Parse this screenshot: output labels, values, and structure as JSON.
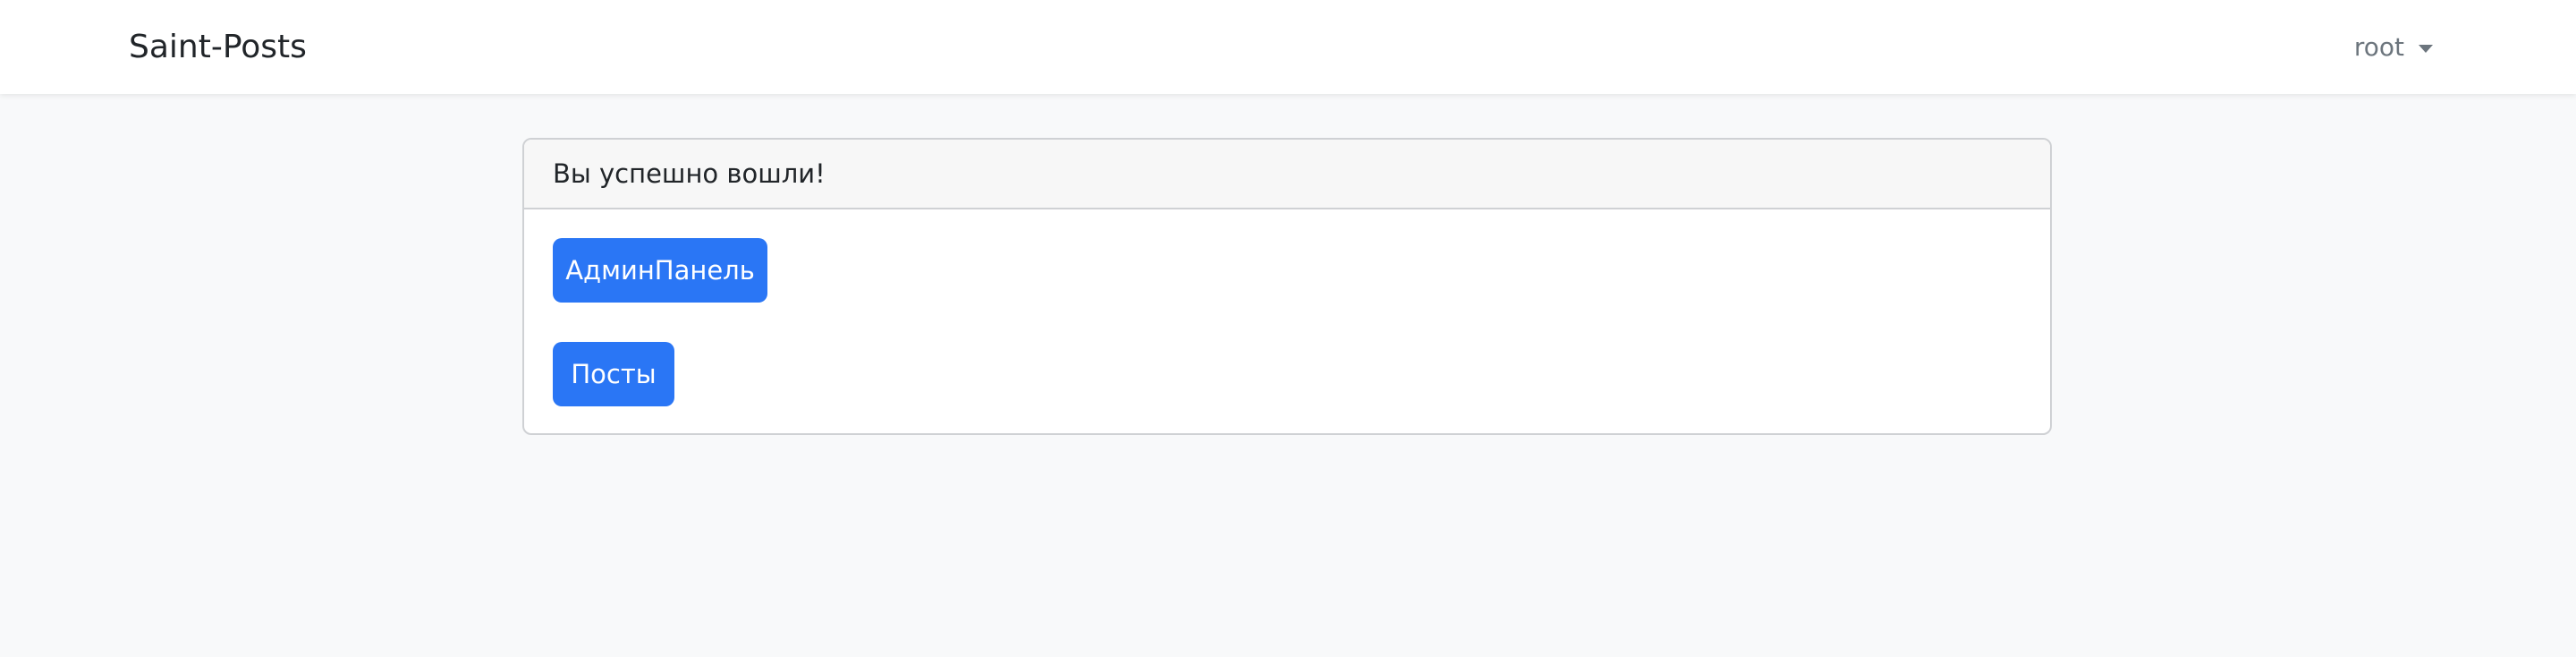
{
  "navbar": {
    "brand": "Saint-Posts",
    "user": "root"
  },
  "card": {
    "header": "Вы успешно вошли!",
    "buttons": {
      "admin": "АдминПанель",
      "posts": "Посты"
    }
  }
}
